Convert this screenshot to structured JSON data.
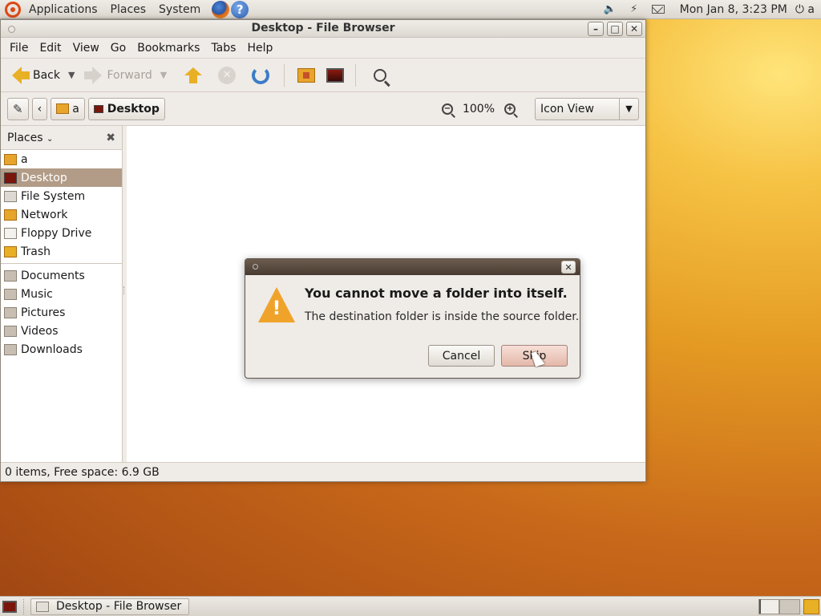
{
  "top_panel": {
    "menus": [
      "Applications",
      "Places",
      "System"
    ],
    "clock": "Mon Jan  8,  3:23 PM",
    "user": "a"
  },
  "window": {
    "title": "Desktop - File Browser",
    "menu": [
      "File",
      "Edit",
      "View",
      "Go",
      "Bookmarks",
      "Tabs",
      "Help"
    ],
    "toolbar": {
      "back_label": "Back",
      "forward_label": "Forward"
    },
    "location": {
      "home_crumb": "a",
      "current_crumb": "Desktop",
      "zoom": "100%",
      "view_mode": "Icon View"
    },
    "sidebar": {
      "header": "Places",
      "places": [
        "a",
        "Desktop",
        "File System",
        "Network",
        "Floppy Drive",
        "Trash"
      ],
      "bookmarks": [
        "Documents",
        "Music",
        "Pictures",
        "Videos",
        "Downloads"
      ],
      "selected": "Desktop"
    },
    "status": "0 items, Free space: 6.9 GB"
  },
  "dialog": {
    "primary": "You cannot move a folder into itself.",
    "secondary": "The destination folder is inside the source folder.",
    "cancel_label": "Cancel",
    "skip_label": "Skip"
  },
  "bottom_panel": {
    "task_label": "Desktop - File Browser"
  },
  "colors": {
    "selection": "#b29c87",
    "dialog_titlebar": "#5a4b3e",
    "accent_orange": "#e8a52b"
  }
}
